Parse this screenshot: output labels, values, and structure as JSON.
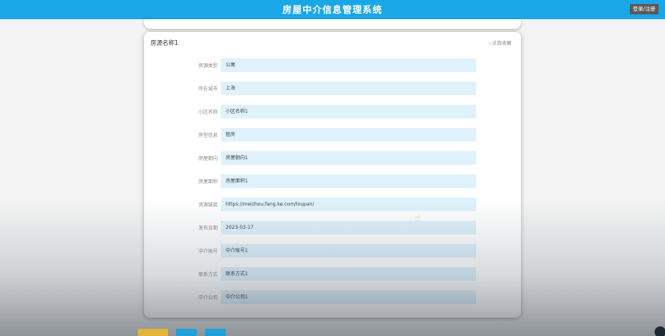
{
  "header": {
    "title": "房屋中介信息管理系统",
    "logout_label": "登录/注册"
  },
  "detail": {
    "title": "房源名称1",
    "favorite_label": "☆点我收藏",
    "fields": [
      {
        "label": "房源类型",
        "value": "公寓"
      },
      {
        "label": "所在城市",
        "value": "上海"
      },
      {
        "label": "小区名称",
        "value": "小区名称1"
      },
      {
        "label": "房型信息",
        "value": "租房"
      },
      {
        "label": "房屋朝向",
        "value": "房屋朝向1"
      },
      {
        "label": "房屋面积",
        "value": "房屋面积1"
      },
      {
        "label": "资源链接",
        "value": "https://meizhou.fang.ke.com/loupan/"
      },
      {
        "label": "发布日期",
        "value": "2023-03-17"
      },
      {
        "label": "中介账号",
        "value": "中介账号1"
      },
      {
        "label": "联系方式",
        "value": "联系方式1"
      },
      {
        "label": "中介公司",
        "value": "中介公司1"
      }
    ]
  },
  "colors": {
    "header_bg": "#1aa7e8",
    "field_bg": "#dff2fc",
    "bottom_button_1": "#e0b53a",
    "bottom_button_2": "#1ea0d8",
    "bottom_button_3": "#1ea0d8"
  }
}
